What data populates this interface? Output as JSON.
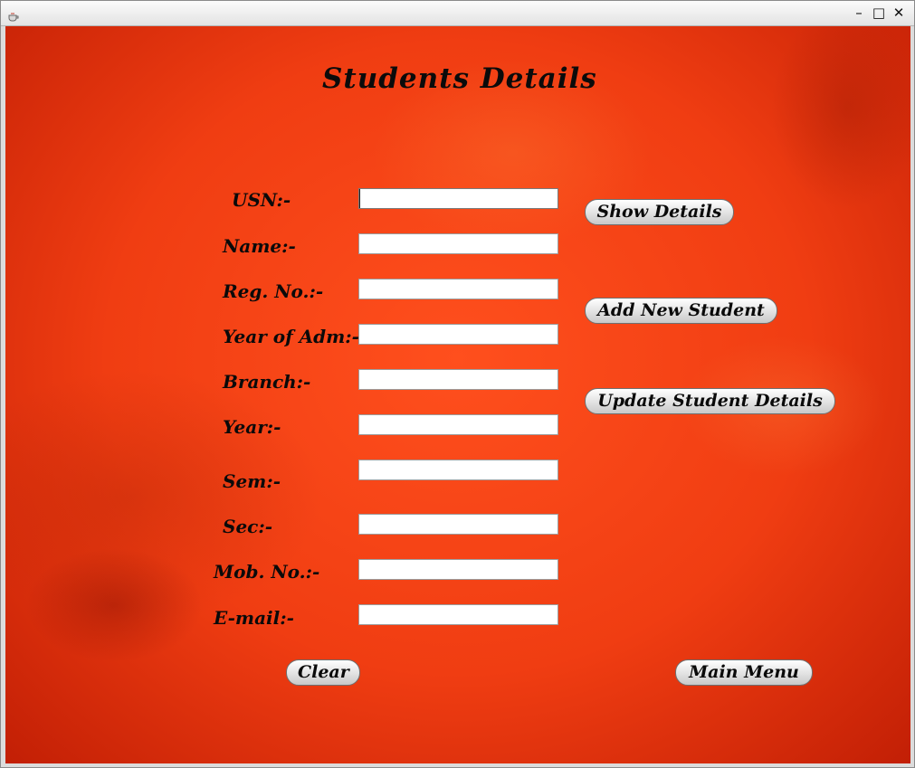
{
  "window": {
    "title": "",
    "controls": {
      "minimize": "–",
      "maximize": "□",
      "close": "✕"
    },
    "icon": "java-cup-icon"
  },
  "form": {
    "heading": "Students Details",
    "fields": [
      {
        "label": "USN:-",
        "value": "",
        "placeholder": ""
      },
      {
        "label": "Name:-",
        "value": "",
        "placeholder": ""
      },
      {
        "label": "Reg. No.:-",
        "value": "",
        "placeholder": ""
      },
      {
        "label": "Year of Adm:-",
        "value": "",
        "placeholder": ""
      },
      {
        "label": "Branch:-",
        "value": "",
        "placeholder": ""
      },
      {
        "label": "Year:-",
        "value": "",
        "placeholder": ""
      },
      {
        "label": "Sem:-",
        "value": "",
        "placeholder": ""
      },
      {
        "label": "Sec:-",
        "value": "",
        "placeholder": ""
      },
      {
        "label": "Mob. No.:-",
        "value": "",
        "placeholder": ""
      },
      {
        "label": "E-mail:-",
        "value": "",
        "placeholder": ""
      }
    ]
  },
  "actions": {
    "show_details": "Show Details",
    "add_new_student": "Add New Student",
    "update_student_details": "Update Student Details",
    "clear": "Clear",
    "main_menu": "Main Menu"
  },
  "theme": {
    "background": "#f03d12",
    "text": "#0a0a0a",
    "button_face": "#e2e2e2"
  }
}
